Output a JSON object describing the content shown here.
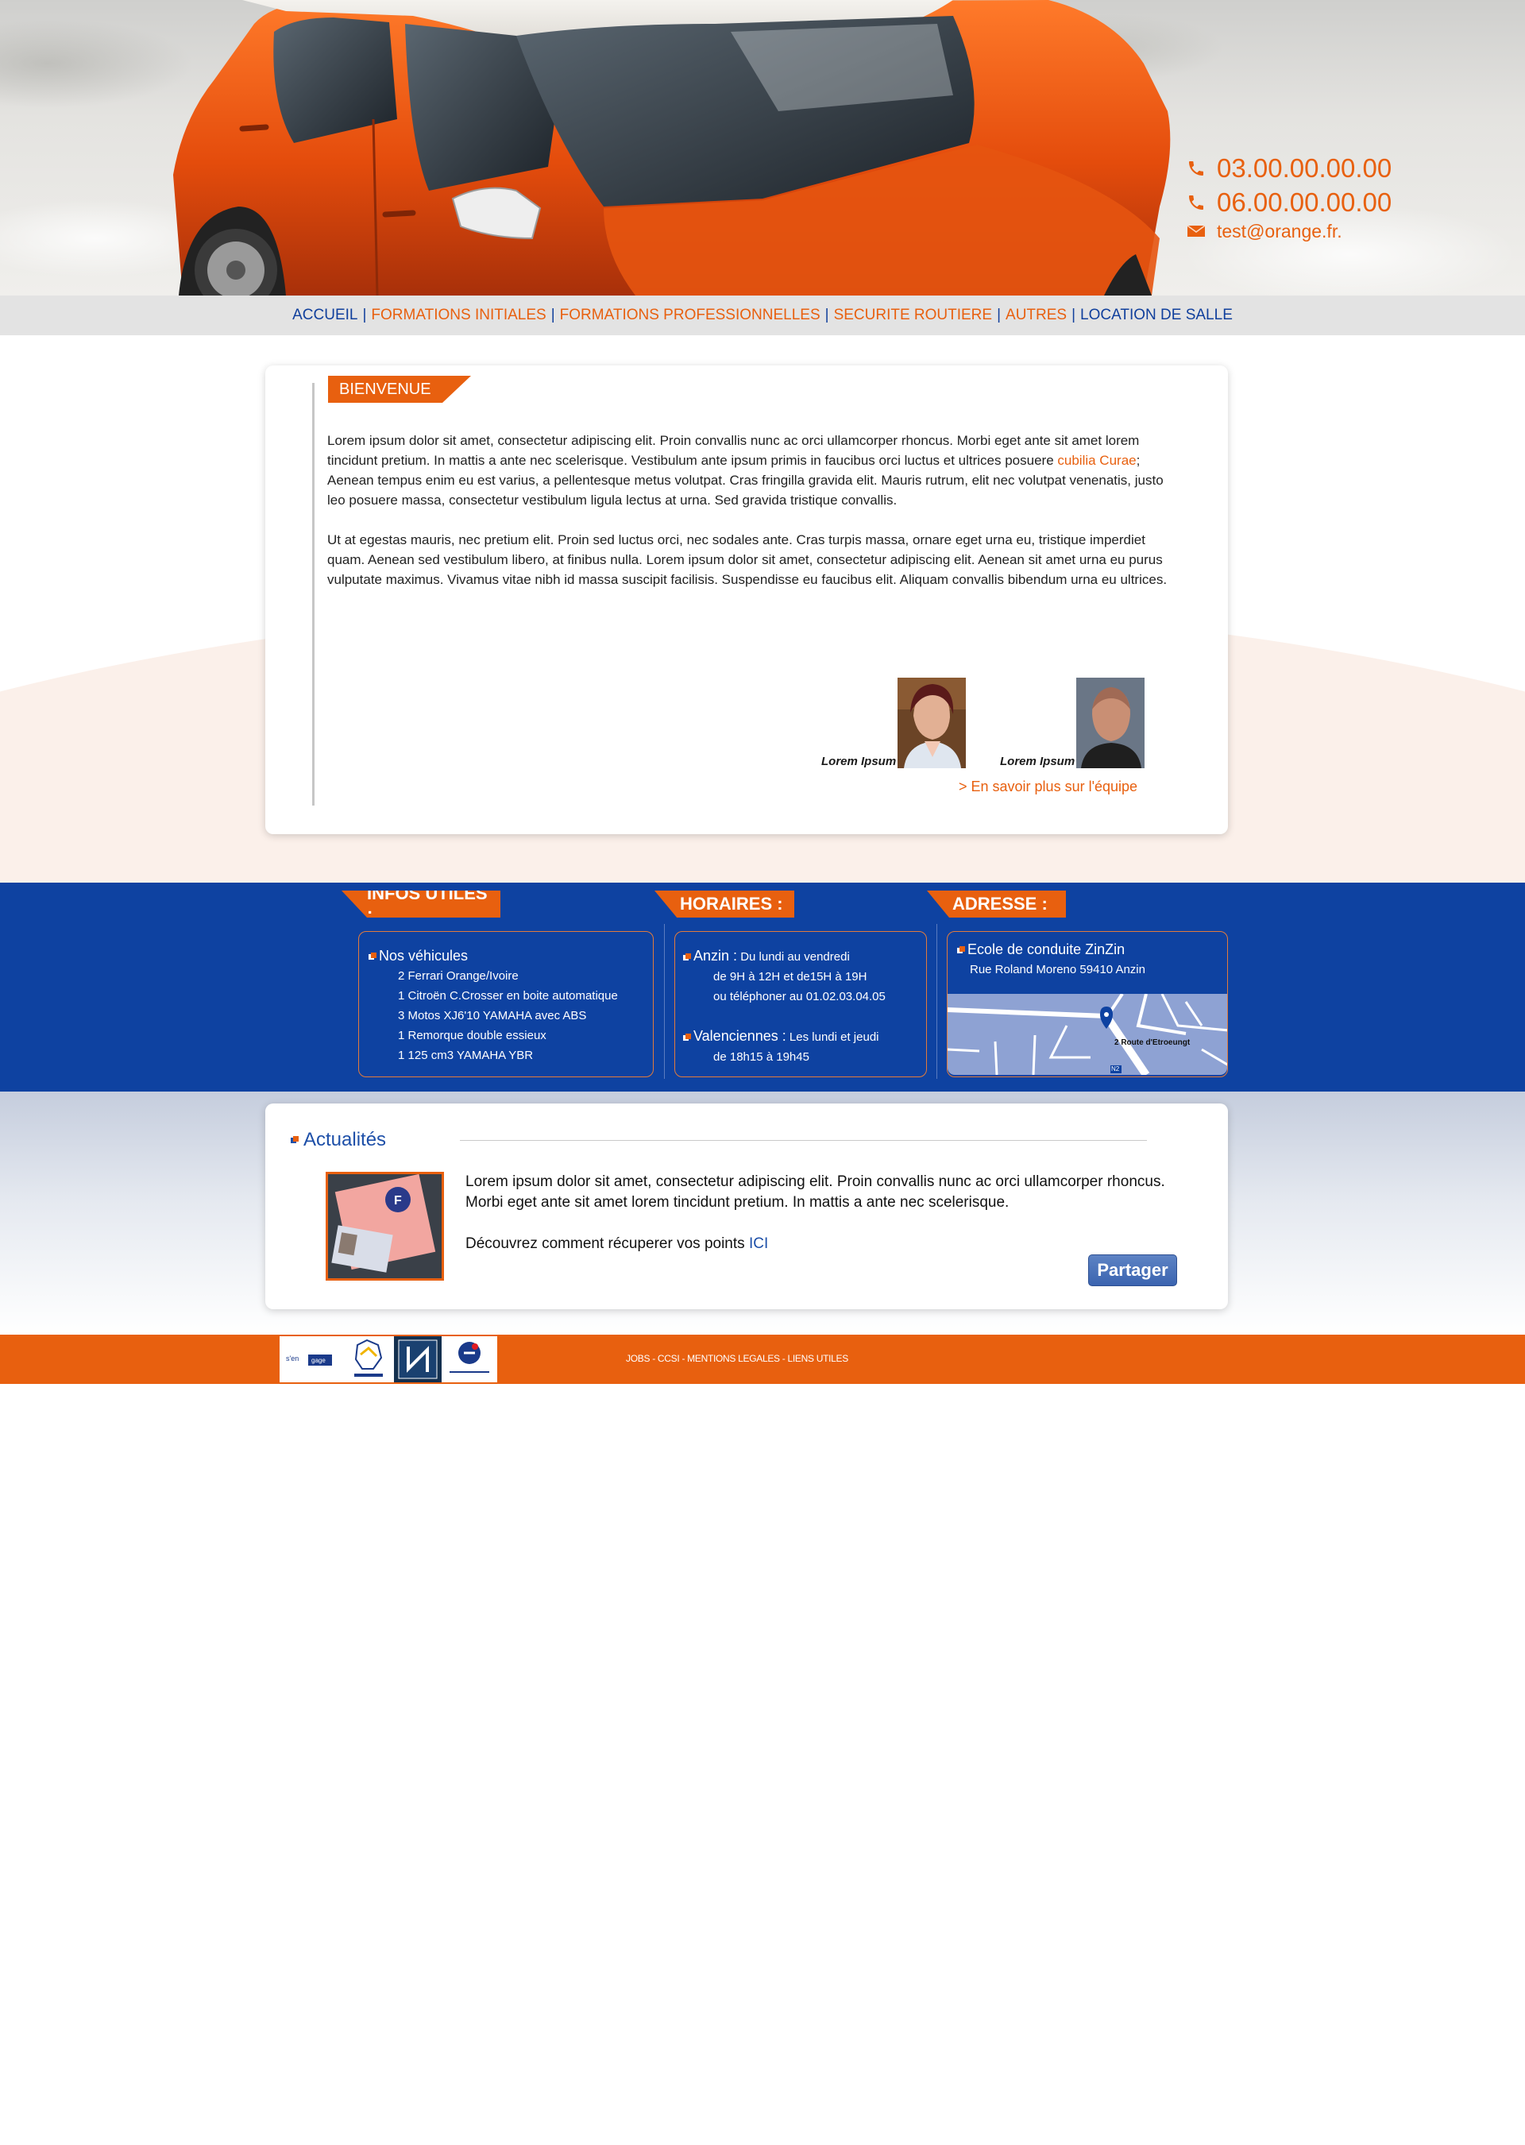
{
  "contact": {
    "phone1": "03.00.00.00.00",
    "phone2": "06.00.00.00.00",
    "email": "test@orange.fr.",
    "phone_icon": "phone-icon",
    "mail_icon": "envelope-icon"
  },
  "nav": {
    "items": [
      {
        "label": "ACCUEIL",
        "color": "#103f9c"
      },
      {
        "label": "FORMATIONS INITIALES",
        "color": "#e8600f"
      },
      {
        "label": "FORMATIONS PROFESSIONNELLES",
        "color": "#e8600f"
      },
      {
        "label": "SECURITE ROUTIERE",
        "color": "#e8600f"
      },
      {
        "label": "AUTRES",
        "color": "#e8600f"
      },
      {
        "label": "LOCATION DE SALLE",
        "color": "#103f9c"
      }
    ],
    "separator": "|"
  },
  "welcome": {
    "heading": "BIENVENUE",
    "p1_before": "Lorem ipsum dolor sit amet, consectetur adipiscing elit. Proin convallis nunc ac orci ullamcorper rhoncus. Morbi eget ante sit amet lorem tincidunt pretium. In mattis a ante nec scelerisque. Vestibulum ante ipsum primis in faucibus orci luctus et ultrices posuere ",
    "p1_link": "cubilia Curae",
    "p1_after": "; Aenean tempus enim eu est varius, a pellentesque metus volutpat. Cras fringilla gravida elit. Mauris rutrum, elit nec volutpat venenatis, justo leo posuere massa, consectetur vestibulum ligula lectus at urna. Sed gravida tristique convallis.",
    "p2": "Ut at egestas mauris, nec pretium elit. Proin sed luctus orci, nec sodales ante. Cras turpis massa, ornare eget urna eu, tristique imperdiet quam. Aenean sed vestibulum libero, at finibus nulla. Lorem ipsum dolor sit amet, consectetur adipiscing elit. Aenean sit amet urna eu purus vulputate maximus. Vivamus vitae nibh id massa suscipit facilisis. Suspendisse eu faucibus elit. Aliquam convallis bibendum urna eu ultrices.",
    "team": [
      {
        "caption": "Lorem Ipsum"
      },
      {
        "caption": "Lorem Ipsum"
      }
    ],
    "more_link": "> En savoir plus sur l'équipe"
  },
  "infos": {
    "heading": "INFOS UTILES :",
    "title": "Nos véhicules",
    "lines": [
      "2 Ferrari Orange/Ivoire",
      "1 Citroën C.Crosser en boite automatique",
      "3 Motos XJ6'10 YAMAHA avec ABS",
      "1 Remorque double essieux",
      "1 125 cm3 YAMAHA YBR"
    ]
  },
  "horaires": {
    "heading": "HORAIRES :",
    "anzin_city": "Anzin :",
    "anzin_days": " Du lundi au vendredi",
    "anzin_lines": [
      "de 9H à 12H et de15H à 19H",
      "ou téléphoner au 01.02.03.04.05"
    ],
    "val_city": "Valenciennes :",
    "val_days": " Les lundi et jeudi",
    "val_lines": [
      "de 18h15 à 19h45"
    ]
  },
  "adresse": {
    "heading": "ADRESSE :",
    "name": "Ecole de conduite ZinZin",
    "street": "Rue Roland Moreno 59410 Anzin",
    "map_label": "2 Route d'Etroeungt",
    "road_sign": "N2"
  },
  "news": {
    "heading": "Actualités",
    "line1": "Lorem ipsum dolor sit amet, consectetur adipiscing elit. Proin convallis nunc ac orci ullamcorper rhoncus.",
    "line2": "Morbi eget ante sit amet lorem tincidunt pretium. In mattis a ante nec scelerisque.",
    "line3": "Découvrez comment récuperer vos points ",
    "link": "ICI",
    "share_button": "Partager"
  },
  "footer": {
    "logo_labels": [
      "L'Europe s'engage en France",
      "Région Hauts-de-France",
      "Conseil Général Nord",
      "pôle emploi"
    ],
    "links": [
      "JOBS",
      "CCSI",
      "MENTIONS LEGALES",
      "LIENS UTILES"
    ],
    "sep": " - "
  },
  "colors": {
    "orange": "#e8600f",
    "blue": "#0e42a1",
    "nav_blue": "#103f9c"
  }
}
